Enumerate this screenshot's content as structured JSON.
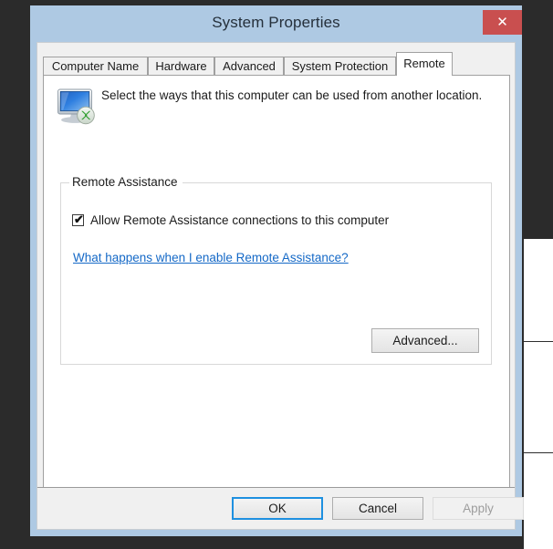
{
  "window": {
    "title": "System Properties",
    "close_label": "✕",
    "close_icon_name": "close-icon"
  },
  "tabs": [
    {
      "label": "Computer Name",
      "active": false
    },
    {
      "label": "Hardware",
      "active": false
    },
    {
      "label": "Advanced",
      "active": false
    },
    {
      "label": "System Protection",
      "active": false
    },
    {
      "label": "Remote",
      "active": true
    }
  ],
  "page": {
    "icon_name": "remote-computer-icon",
    "description": "Select the ways that this computer can be used from another location."
  },
  "group": {
    "legend": "Remote Assistance",
    "checkbox": {
      "label": "Allow Remote Assistance connections to this computer",
      "checked": true,
      "check_glyph": "✔"
    },
    "help_link": "What happens when I enable Remote Assistance?",
    "advanced_button": "Advanced..."
  },
  "footer": {
    "ok": "OK",
    "cancel": "Cancel",
    "apply": "Apply",
    "apply_disabled": true
  },
  "colors": {
    "titlebar": "#aec9e3",
    "close_button": "#c94f4f",
    "link": "#1569c7",
    "default_button_border": "#1e90e0",
    "desktop": "#2b2b2b",
    "dialog_face": "#f0f0f0"
  }
}
